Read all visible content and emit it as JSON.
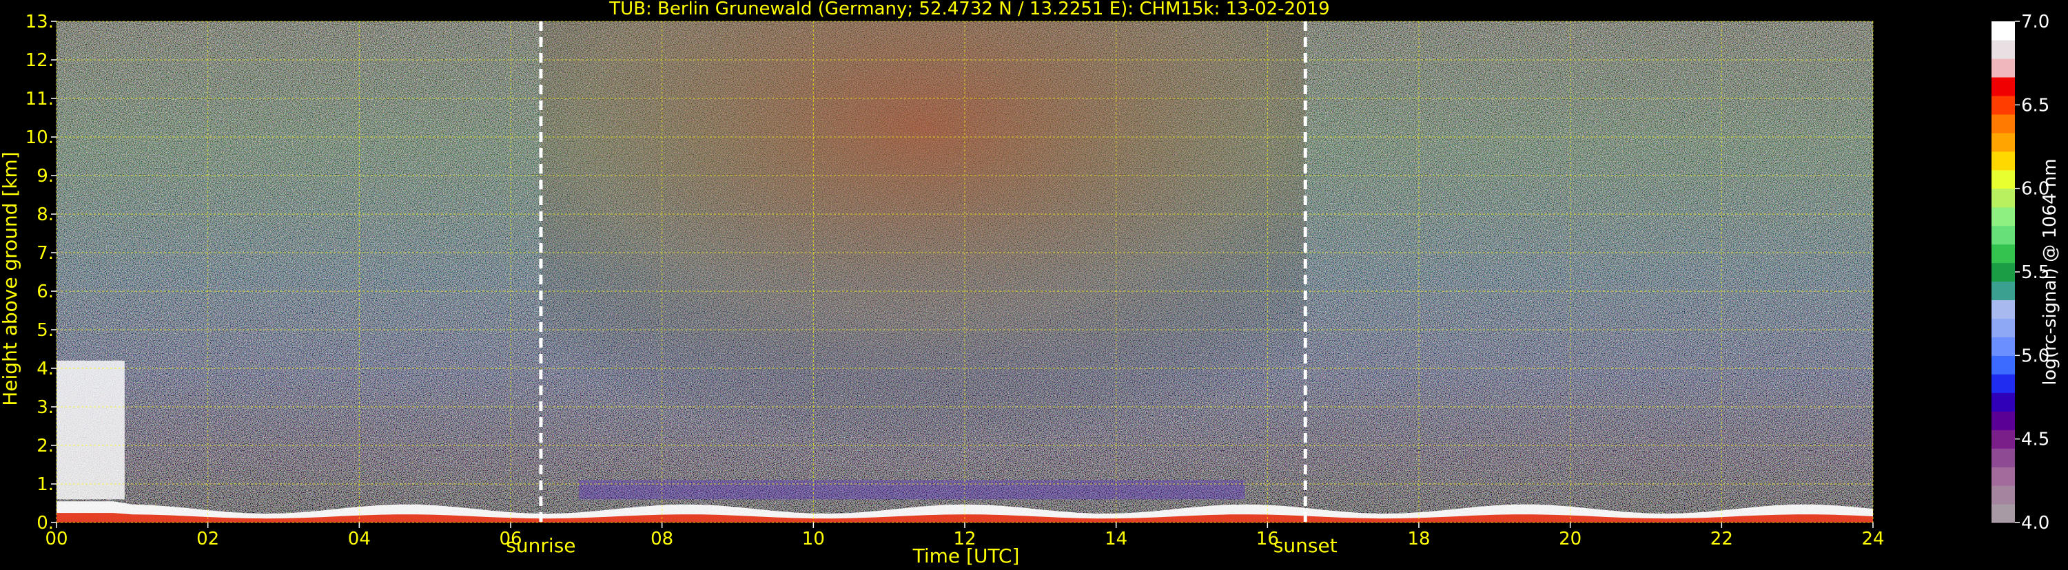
{
  "chart_data": {
    "type": "heatmap",
    "title": "TUB: Berlin Grunewald (Germany; 52.4732 N / 13.2251 E):    CHM15k: 13-02-2019",
    "xlabel": "Time [UTC]",
    "ylabel": "Height above ground [km]",
    "xlim": [
      0,
      24
    ],
    "ylim": [
      0,
      13
    ],
    "x_ticks": [
      "00",
      "02",
      "04",
      "06",
      "08",
      "10",
      "12",
      "14",
      "16",
      "18",
      "20",
      "22",
      "24"
    ],
    "y_ticks": [
      "0.",
      "1.",
      "2.",
      "3.",
      "4.",
      "5.",
      "6.",
      "7.",
      "8.",
      "9.",
      "10.",
      "11.",
      "12.",
      "13."
    ],
    "grid": true,
    "colorbar": {
      "label": "log(rc-signal) @ 1064 nm",
      "range": [
        4.0,
        7.0
      ],
      "ticks": [
        "4.0",
        "4.5",
        "5.0",
        "5.5",
        "6.0",
        "6.5",
        "7.0"
      ],
      "colors": [
        "#a89aa5",
        "#a4849e",
        "#a26b9b",
        "#8e4a93",
        "#7a1f8a",
        "#5a0095",
        "#2f00b8",
        "#1f2df0",
        "#3c6cff",
        "#6b8fff",
        "#8fa8f6",
        "#a7b9ef",
        "#3aa090",
        "#1b9d45",
        "#35c350",
        "#68e07a",
        "#8ef080",
        "#b8f060",
        "#e8ff30",
        "#ffd800",
        "#ffa400",
        "#ff7a00",
        "#ff3d00",
        "#f00000",
        "#f0b8bc",
        "#e8e0e2",
        "#ffffff"
      ]
    },
    "markers": [
      {
        "label": "sunrise",
        "x": 6.4
      },
      {
        "label": "sunset",
        "x": 16.5
      }
    ]
  }
}
